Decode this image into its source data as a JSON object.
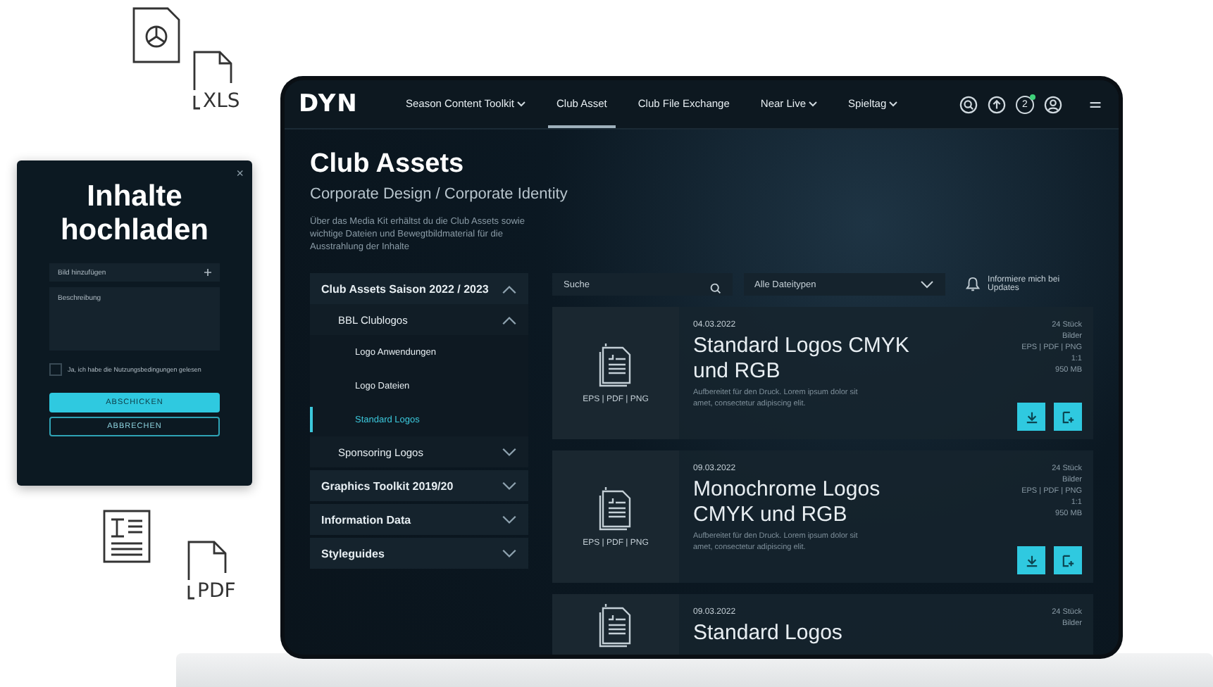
{
  "decor_icons": [
    {
      "kind": "chart-doc"
    },
    {
      "kind": "file",
      "label": "XLS"
    },
    {
      "kind": "text-doc"
    },
    {
      "kind": "file",
      "label": "PDF"
    }
  ],
  "dialog": {
    "close": "×",
    "title": "Inhalte hochladen",
    "fields": [
      {
        "placeholder": "Bild hinzufügen",
        "kind": "add"
      },
      {
        "placeholder": "Beschreibung",
        "kind": "area"
      }
    ],
    "consent": {
      "label": "Ja, ich habe die Nutzungsbedingungen gelesen",
      "checked": false
    },
    "buttons": [
      {
        "label": "ABSCHICKEN",
        "kind": "primary"
      },
      {
        "label": "ABBRECHEN",
        "kind": "secondary"
      }
    ]
  },
  "nav": {
    "logo": "DYN",
    "items": [
      {
        "label": "Season Content Toolkit",
        "dropdown": true,
        "selected": false
      },
      {
        "label": "Club Asset",
        "dropdown": false,
        "selected": true
      },
      {
        "label": "Club File Exchange",
        "dropdown": false,
        "selected": false
      },
      {
        "label": "Near Live",
        "dropdown": true,
        "selected": false
      },
      {
        "label": "Spieltag",
        "dropdown": true,
        "selected": false
      }
    ],
    "notifications": "2"
  },
  "hero": {
    "title": "Club Assets",
    "subtitle": "Corporate Design / Corporate Identity",
    "description": "Über das Media Kit erhältst du die Club Assets sowie wichtige Dateien und Bewegtbildmaterial für die Ausstrahlung der Inhalte"
  },
  "sidebar": [
    {
      "label": "Club Assets Saison 2022 / 2023",
      "expanded": true,
      "children": [
        {
          "label": "BBL Clublogos",
          "expanded": true,
          "children": [
            {
              "label": "Logo Anwendungen",
              "selected": false
            },
            {
              "label": "Logo Dateien",
              "selected": false
            },
            {
              "label": "Standard Logos",
              "selected": true
            }
          ]
        },
        {
          "label": "Sponsoring Logos",
          "expanded": false
        }
      ]
    },
    {
      "label": "Graphics Toolkit 2019/20",
      "expanded": false
    },
    {
      "label": "Information Data",
      "expanded": false
    },
    {
      "label": "Styleguides",
      "expanded": false
    }
  ],
  "toolbar": {
    "search": {
      "placeholder": "Suche"
    },
    "filter": "Alle Dateitypen",
    "notify": "Informiere mich bei Updates"
  },
  "cards": [
    {
      "formats": "EPS | PDF | PNG",
      "date": "04.03.2022",
      "title": "Standard Logos CMYK und RGB",
      "description": "Aufbereitet für den Druck. Lorem ipsum dolor sit amet, consectetur adipiscing elit.",
      "meta": [
        "24 Stück",
        "Bilder",
        "EPS | PDF | PNG",
        "1:1",
        "950 MB"
      ],
      "actions": true
    },
    {
      "formats": "EPS | PDF | PNG",
      "date": "09.03.2022",
      "title": "Monochrome Logos CMYK und RGB",
      "description": "Aufbereitet für den Druck. Lorem ipsum dolor sit amet, consectetur adipiscing elit.",
      "meta": [
        "24 Stück",
        "Bilder",
        "EPS | PDF | PNG",
        "1:1",
        "950 MB"
      ],
      "actions": true
    },
    {
      "date": "09.03.2022",
      "title": "Standard Logos",
      "meta": [
        "24 Stück",
        "Bilder"
      ],
      "actions": false
    }
  ]
}
